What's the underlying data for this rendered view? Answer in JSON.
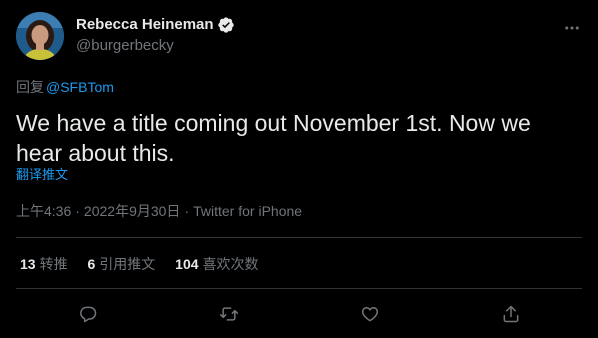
{
  "author": {
    "display_name": "Rebecca Heineman",
    "handle": "@burgerbecky",
    "verified": true
  },
  "reply": {
    "prefix": "回复",
    "mention": "@SFBTom"
  },
  "tweet": {
    "text": "We have a title coming out November 1st. Now we hear about this.",
    "translate_label": "翻译推文"
  },
  "meta": {
    "time": "上午4:36",
    "separator1": "·",
    "date": "2022年9月30日",
    "separator2": "·",
    "source": "Twitter for iPhone"
  },
  "stats": [
    {
      "count": "13",
      "label": "转推"
    },
    {
      "count": "6",
      "label": "引用推文"
    },
    {
      "count": "104",
      "label": "喜欢次数"
    }
  ],
  "actions": [
    {
      "icon": "reply-icon"
    },
    {
      "icon": "retweet-icon"
    },
    {
      "icon": "like-icon"
    },
    {
      "icon": "share-icon"
    }
  ],
  "colors": {
    "background": "#000000",
    "text": "#e7e9ea",
    "secondary": "#71767b",
    "link": "#1d9bf0",
    "divider": "#2f3336"
  }
}
